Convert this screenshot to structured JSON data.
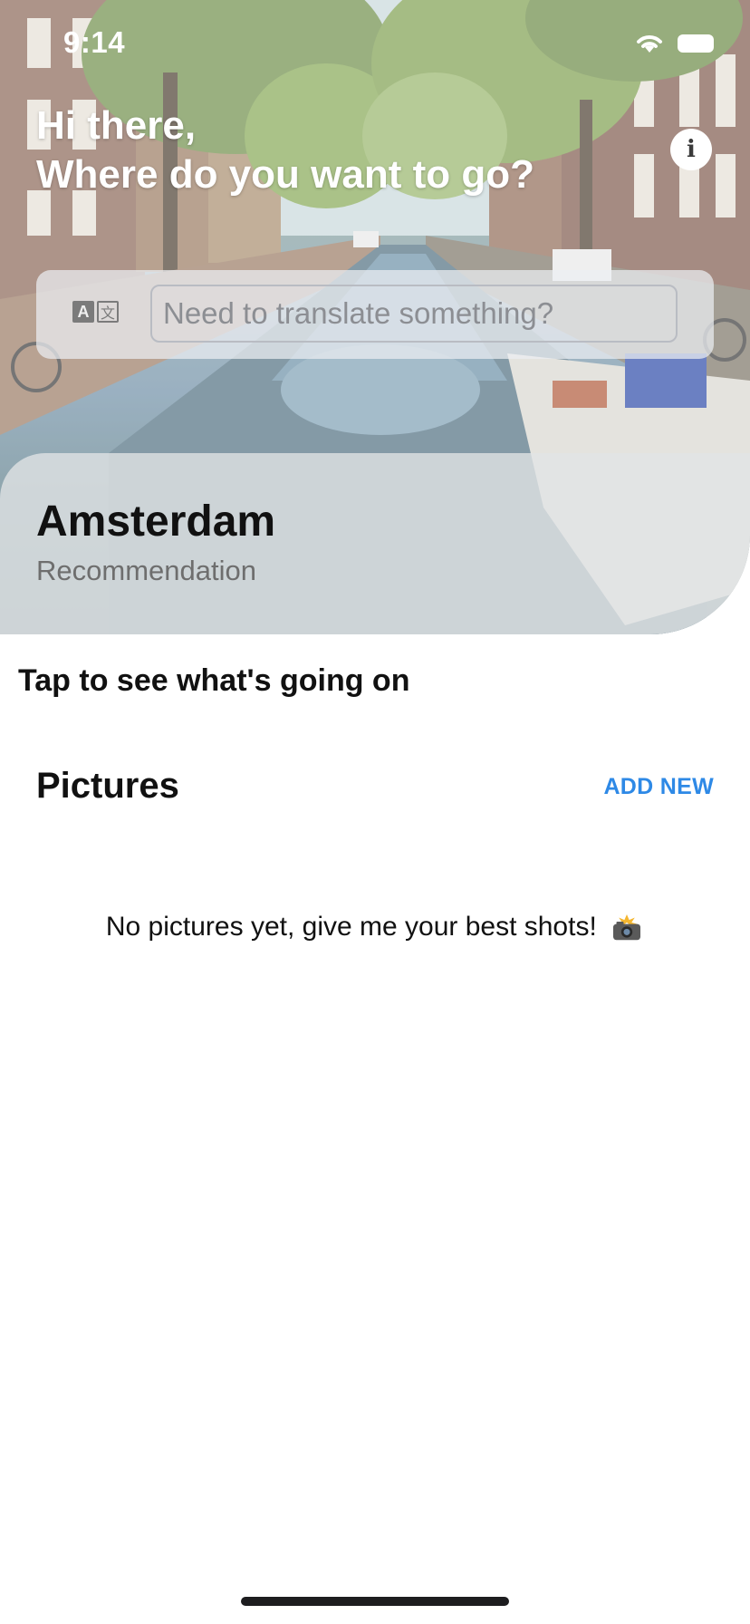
{
  "status_bar": {
    "time": "9:14"
  },
  "header": {
    "greeting_line1": "Hi there,",
    "greeting_line2": "Where do you want to go?"
  },
  "translate": {
    "placeholder": "Need to translate something?",
    "icon_letter_a": "A",
    "icon_letter_b": "文"
  },
  "city": {
    "name": "Amsterdam",
    "subtitle": "Recommendation"
  },
  "tap_hint": "Tap to see what's going on",
  "pictures": {
    "title": "Pictures",
    "add_new_label": "ADD NEW",
    "empty_message": "No pictures yet, give me your best shots!"
  },
  "icons": {
    "info": "info-icon",
    "wifi": "wifi-icon",
    "battery": "battery-icon",
    "translate": "translate-icon",
    "camera": "camera-flash-icon"
  },
  "colors": {
    "accent": "#2e89e6",
    "text_primary": "#111111",
    "text_secondary": "#6e6e6e"
  }
}
